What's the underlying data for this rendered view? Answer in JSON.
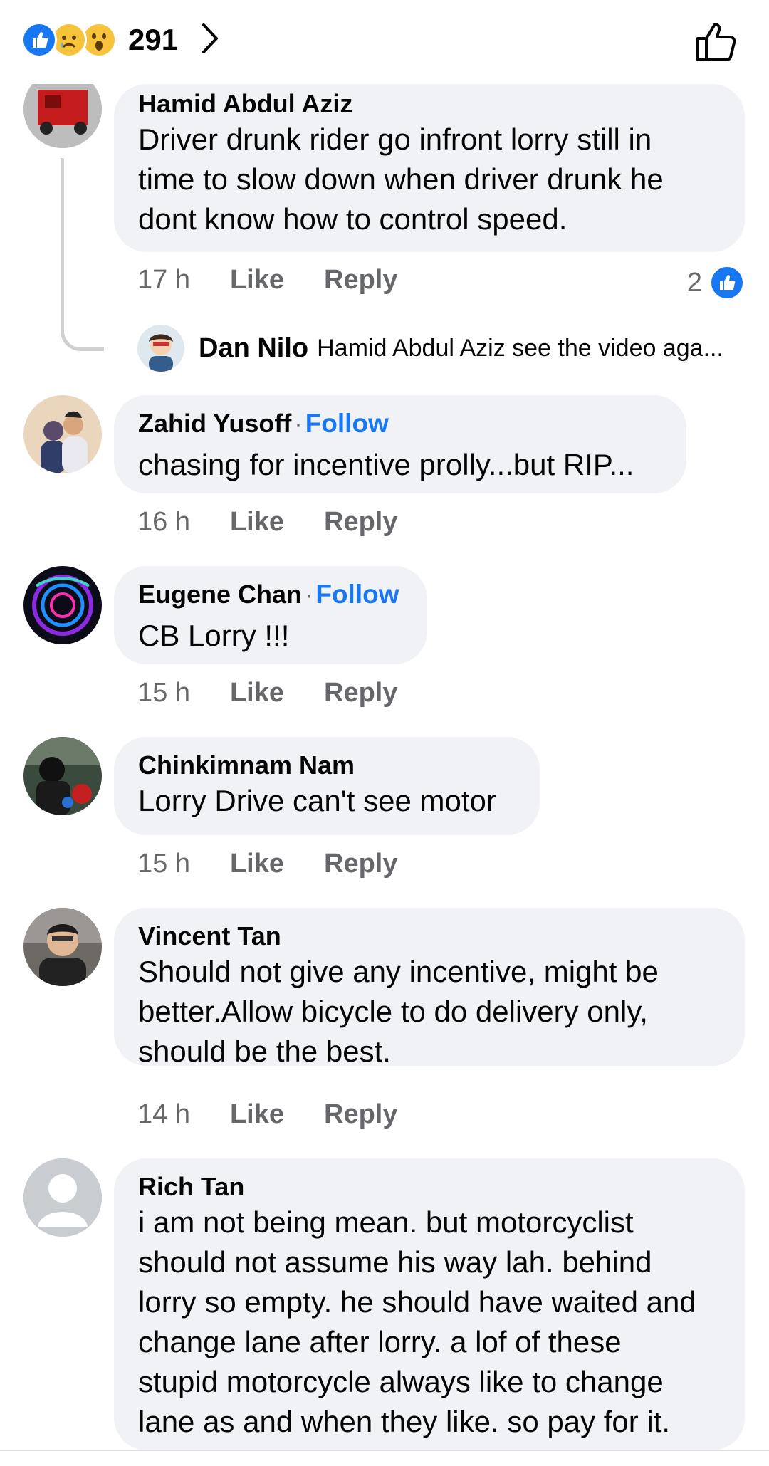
{
  "header": {
    "reaction_count": "291",
    "reactions": [
      "like",
      "sad",
      "wow"
    ]
  },
  "comments": [
    {
      "name": "Hamid Abdul Aziz",
      "text_lines": [
        "Driver drunk rider go infront lorry still in",
        "time to slow down when driver drunk he",
        "dont know how to control speed."
      ],
      "time": "17 h",
      "like": "Like",
      "reply": "Reply",
      "like_count": "2",
      "reply_preview": {
        "name": "Dan Nilo",
        "text": "Hamid Abdul Aziz see the video aga..."
      }
    },
    {
      "name": "Zahid Yusoff",
      "follow": "Follow",
      "text_lines": [
        "chasing for incentive prolly...but RIP..."
      ],
      "time": "16 h",
      "like": "Like",
      "reply": "Reply"
    },
    {
      "name": "Eugene Chan",
      "follow": "Follow",
      "text_lines": [
        "CB Lorry !!!"
      ],
      "time": "15 h",
      "like": "Like",
      "reply": "Reply"
    },
    {
      "name": "Chinkimnam Nam",
      "text_lines": [
        "Lorry Drive can't see motor"
      ],
      "time": "15 h",
      "like": "Like",
      "reply": "Reply"
    },
    {
      "name": "Vincent Tan",
      "text_lines": [
        "Should not give any incentive, might be",
        "better.Allow bicycle to do delivery only,",
        "should be the best."
      ],
      "time": "14 h",
      "like": "Like",
      "reply": "Reply"
    },
    {
      "name": "Rich Tan",
      "text_lines": [
        "i am not being mean. but motorcyclist",
        "should not assume his way lah. behind",
        "lorry so empty. he should have waited and",
        "change lane after lorry. a lof of these",
        "stupid motorcycle always like to change",
        "lane as and when they like. so pay for it."
      ]
    }
  ],
  "colors": {
    "accent": "#1877f2",
    "bubble": "#f0f2f5",
    "secondary_text": "#65676b"
  },
  "icons": [
    "like-reaction-icon",
    "sad-reaction-icon",
    "wow-reaction-icon",
    "chevron-right-icon",
    "thumbs-up-outline-icon"
  ]
}
